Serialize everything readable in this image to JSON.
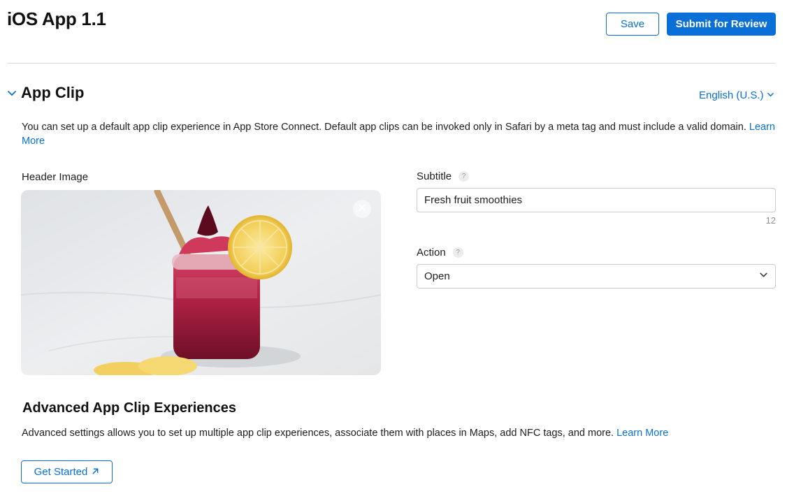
{
  "header": {
    "title": "iOS App 1.1",
    "save_label": "Save",
    "submit_label": "Submit for Review"
  },
  "section": {
    "title": "App Clip",
    "language": "English (U.S.)",
    "description": "You can set up a default app clip experience in App Store Connect. Default app clips can be invoked only in Safari by a meta tag and must include a valid domain.",
    "learn_more": "Learn More"
  },
  "form": {
    "header_image_label": "Header Image",
    "subtitle_label": "Subtitle",
    "subtitle_value": "Fresh fruit smoothies",
    "subtitle_char_count": "12",
    "action_label": "Action",
    "action_value": "Open",
    "help_glyph": "?"
  },
  "advanced": {
    "title": "Advanced App Clip Experiences",
    "description": "Advanced settings allows you to set up multiple app clip experiences, associate them with places in Maps, add NFC tags, and more.",
    "learn_more": "Learn More",
    "get_started_label": "Get Started"
  },
  "icons": {
    "collapse": "chevron-down-icon",
    "language": "chevron-down-icon",
    "help": "question-mark-icon",
    "remove_image": "close-icon",
    "select": "chevron-down-icon",
    "external": "arrow-up-right-icon"
  },
  "colors": {
    "accent": "#0a6fd6",
    "text": "#1d1d1f",
    "border": "#c9c9ce",
    "divider": "#d8d8dc",
    "muted": "#8e8e93"
  }
}
